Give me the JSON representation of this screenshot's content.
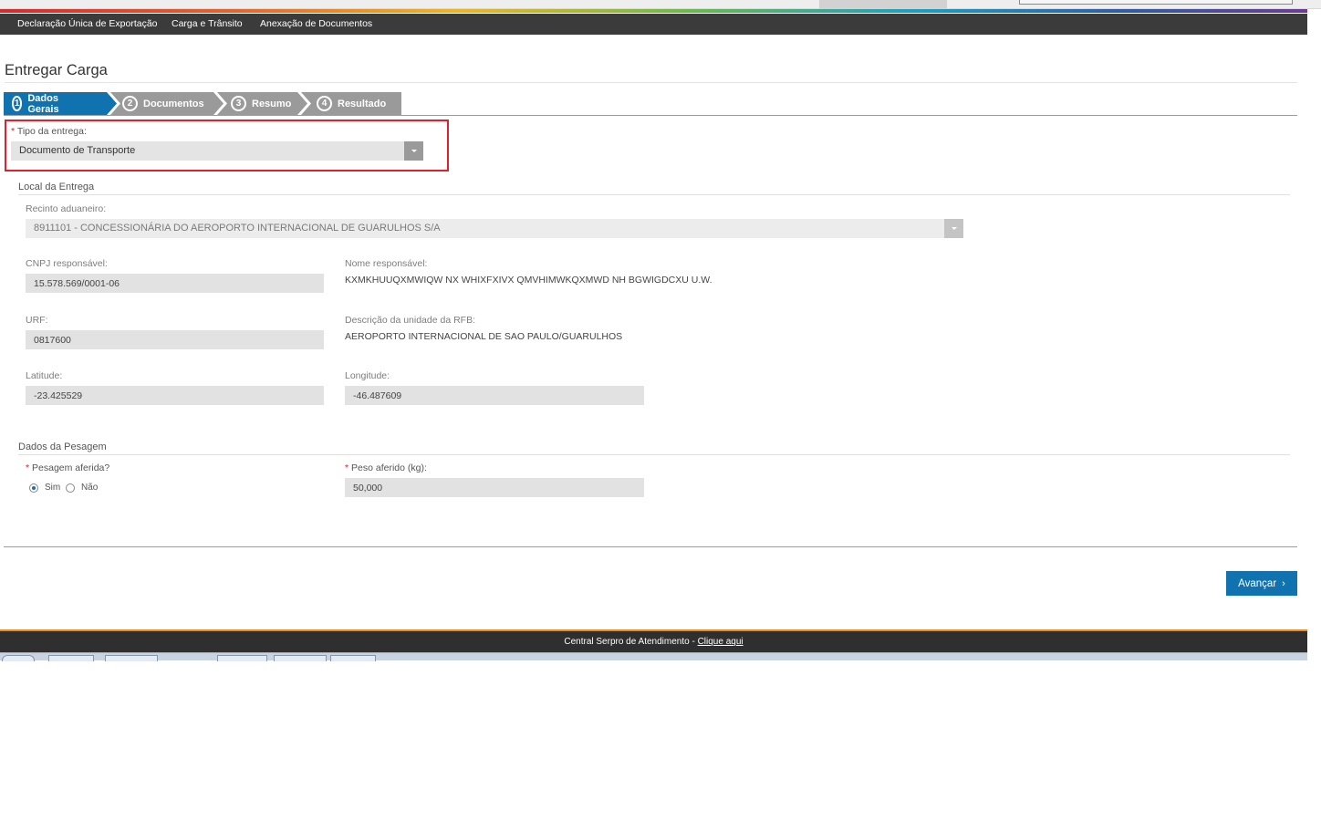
{
  "nav": {
    "items": [
      "Declaração Única de Exportação",
      "Carga e Trânsito",
      "Anexação de Documentos"
    ]
  },
  "page": {
    "title": "Entregar Carga"
  },
  "steps": [
    {
      "num": "1",
      "label": "Dados Gerais",
      "active": true
    },
    {
      "num": "2",
      "label": "Documentos",
      "active": false
    },
    {
      "num": "3",
      "label": "Resumo",
      "active": false
    },
    {
      "num": "4",
      "label": "Resultado",
      "active": false
    }
  ],
  "tipo_entrega": {
    "required": "*",
    "label": "Tipo da entrega:",
    "value": "Documento de Transporte"
  },
  "local_entrega": {
    "title": "Local da Entrega",
    "recinto_label": "Recinto aduaneiro:",
    "recinto_value": "8911101 - CONCESSIONÁRIA DO AEROPORTO INTERNACIONAL DE GUARULHOS S/A",
    "cnpj_label": "CNPJ responsável:",
    "cnpj_value": "15.578.569/0001-06",
    "nome_label": "Nome responsável:",
    "nome_value": "KXMKHUUQXMWIQW NX WHIXFXIVX QMVHIMWKQXMWD NH BGWIGDCXU U.W.",
    "urf_label": "URF:",
    "urf_value": "0817600",
    "descricao_label": "Descrição da unidade da RFB:",
    "descricao_value": "AEROPORTO INTERNACIONAL DE SAO PAULO/GUARULHOS",
    "latitude_label": "Latitude:",
    "latitude_value": "-23.425529",
    "longitude_label": "Longitude:",
    "longitude_value": "-46.487609"
  },
  "pesagem": {
    "title": "Dados da Pesagem",
    "required": "*",
    "aferida_label": "Pesagem aferida?",
    "sim_label": "Sim",
    "nao_label": "Não",
    "selected": "Sim",
    "peso_label": "Peso aferido (kg):",
    "peso_value": "50,000"
  },
  "actions": {
    "avancar_label": "Avançar",
    "avancar_icon": "chevron-right-icon"
  },
  "footer": {
    "text": "Central Serpro de Atendimento - ",
    "link": "Clique aqui"
  },
  "colors": {
    "primary": "#1073b0",
    "step_inactive": "#9a9a9a",
    "highlight": "#e0202a",
    "footer_accent": "#f08a1c"
  }
}
